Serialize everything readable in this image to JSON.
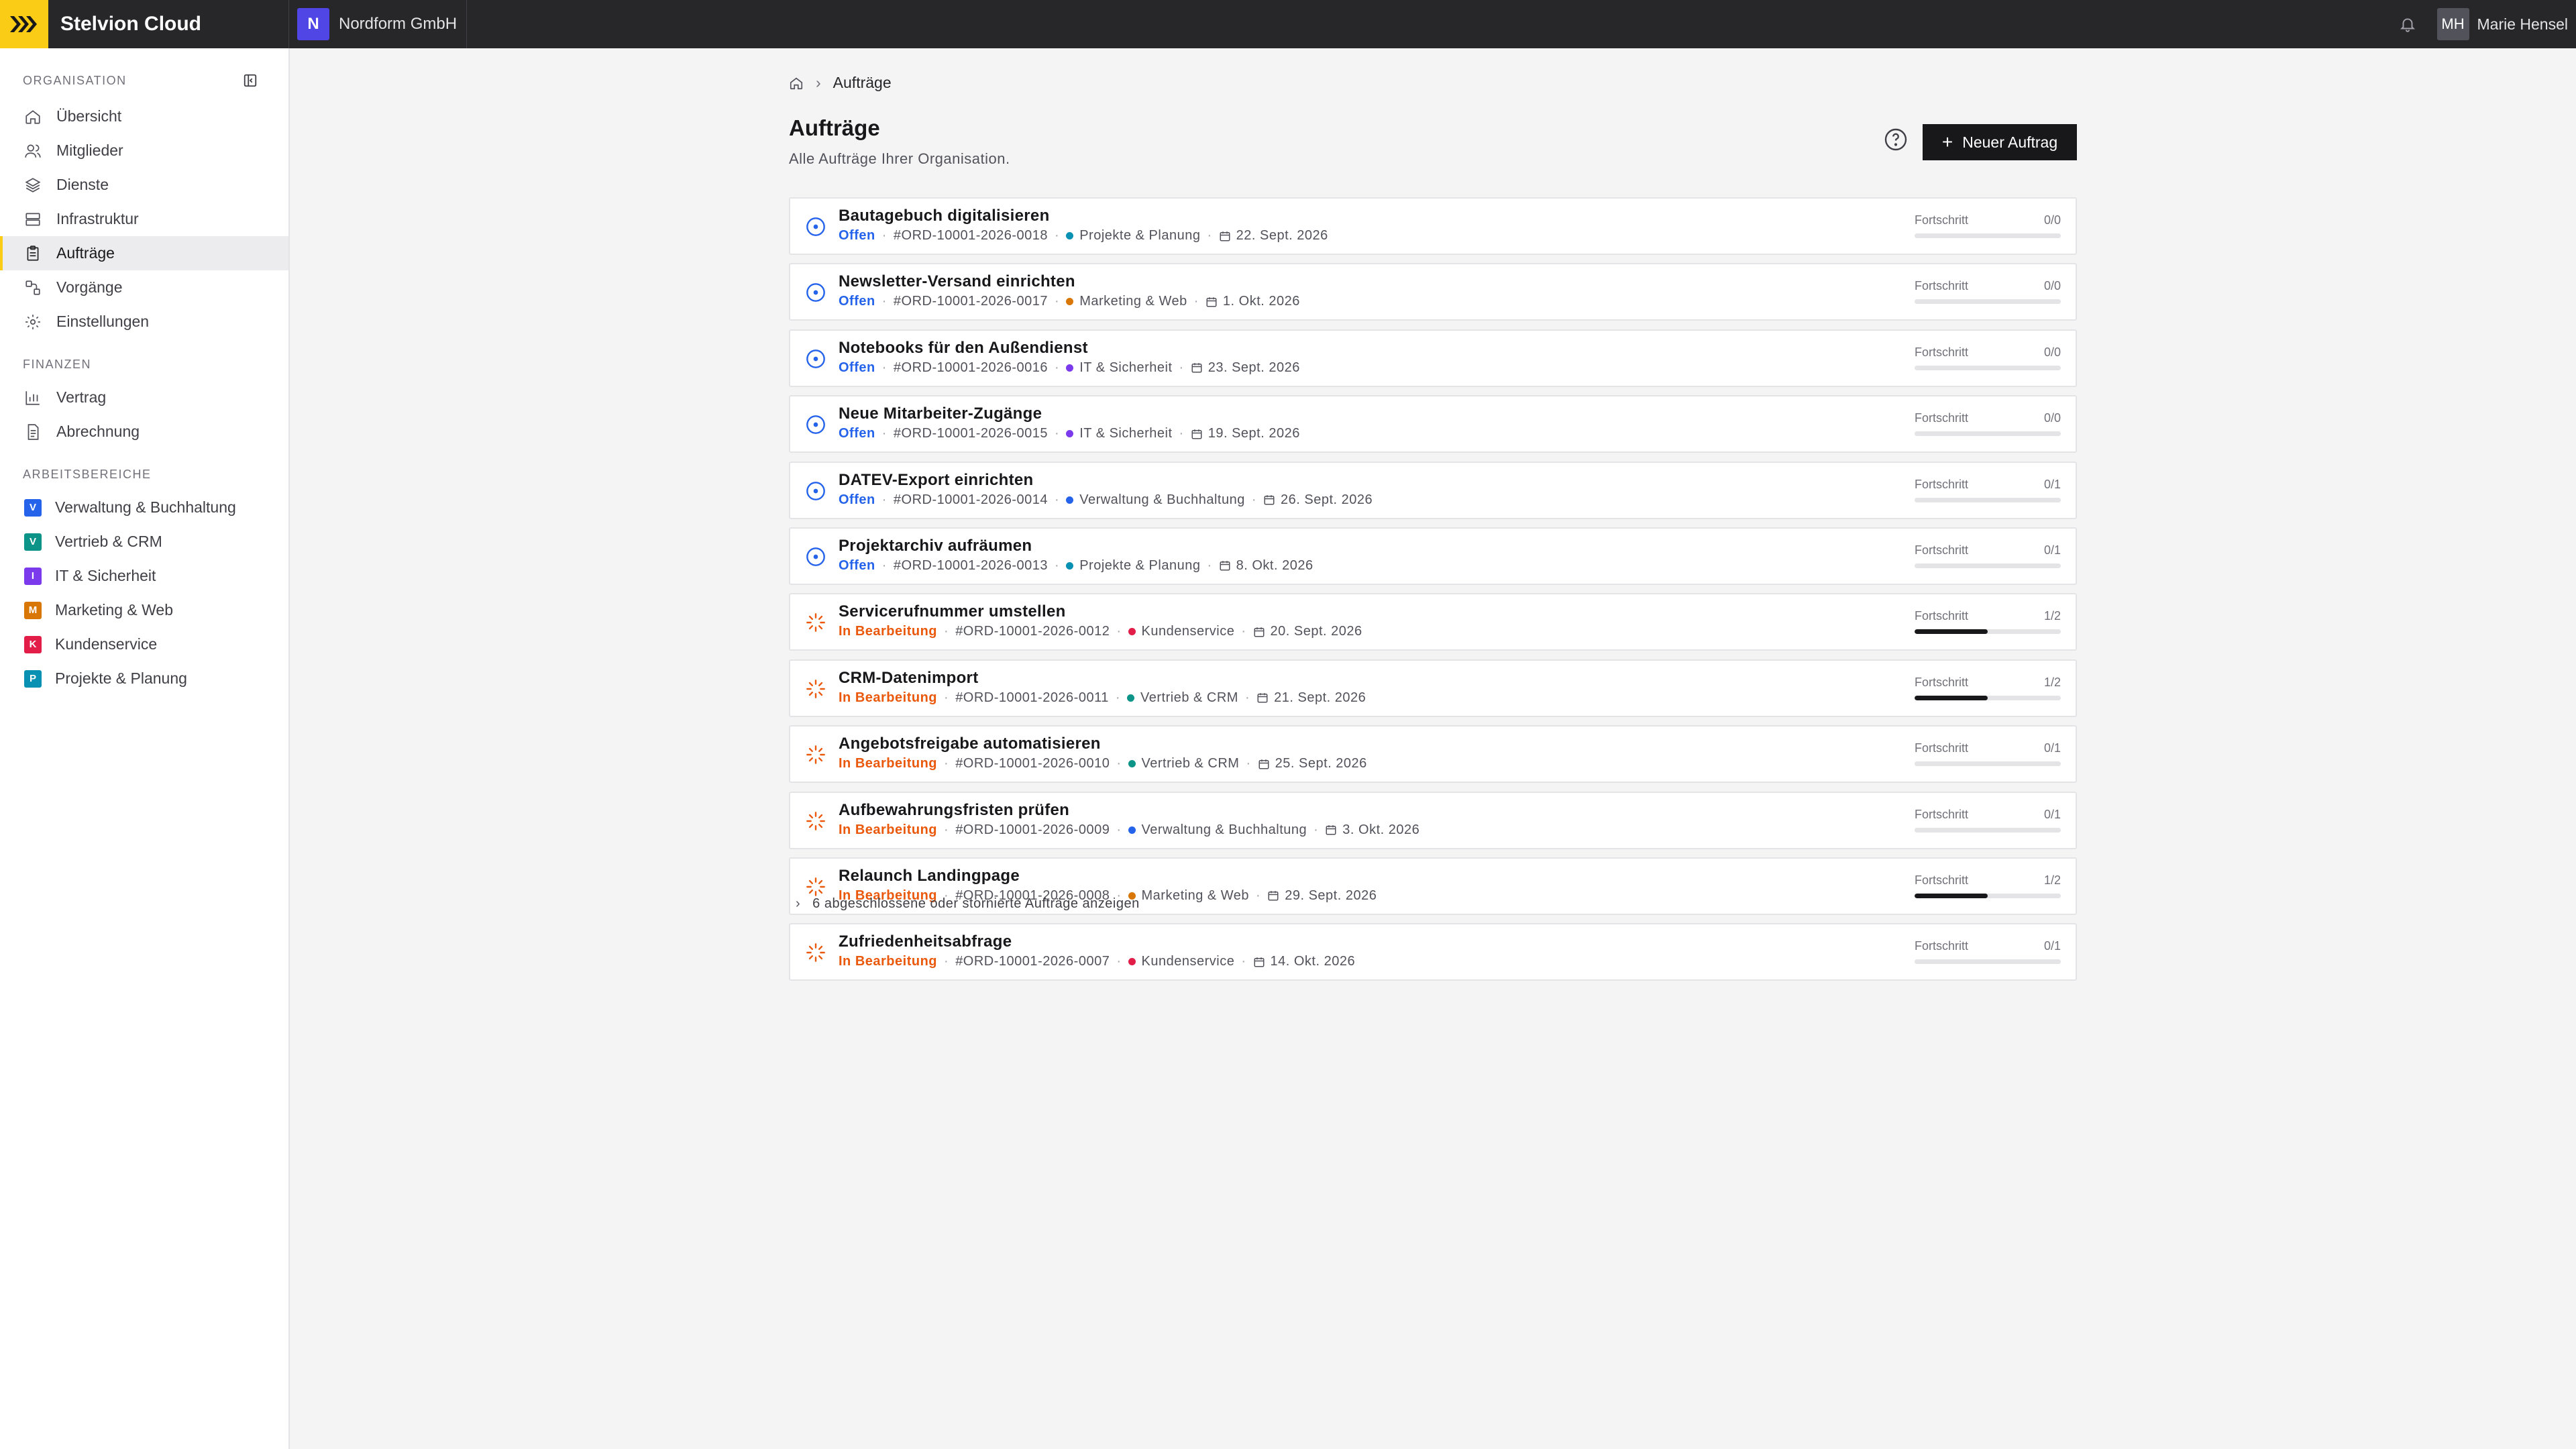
{
  "app": {
    "brand": "Stelvion Cloud",
    "org_initial": "N",
    "org_name": "Nordform GmbH"
  },
  "user": {
    "initials": "MH",
    "name": "Marie Hensel"
  },
  "sidebar": {
    "sections": [
      {
        "label": "ORGANISATION",
        "items": [
          {
            "label": "Übersicht",
            "icon": "home-icon"
          },
          {
            "label": "Mitglieder",
            "icon": "users-icon"
          },
          {
            "label": "Dienste",
            "icon": "layers-icon"
          },
          {
            "label": "Infrastruktur",
            "icon": "server-icon"
          },
          {
            "label": "Aufträge",
            "icon": "clipboard-icon",
            "active": true
          },
          {
            "label": "Vorgänge",
            "icon": "workflow-icon"
          },
          {
            "label": "Einstellungen",
            "icon": "gear-icon"
          }
        ]
      },
      {
        "label": "FINANZEN",
        "items": [
          {
            "label": "Vertrag",
            "icon": "bar-chart-icon"
          },
          {
            "label": "Abrechnung",
            "icon": "document-icon"
          }
        ]
      },
      {
        "label": "ARBEITSBEREICHE",
        "items": [
          {
            "label": "Verwaltung & Buchhaltung",
            "letter": "V",
            "color": "#2563eb"
          },
          {
            "label": "Vertrieb & CRM",
            "letter": "V",
            "color": "#0d9488"
          },
          {
            "label": "IT & Sicherheit",
            "letter": "I",
            "color": "#7c3aed"
          },
          {
            "label": "Marketing & Web",
            "letter": "M",
            "color": "#d97706"
          },
          {
            "label": "Kundenservice",
            "letter": "K",
            "color": "#e11d48"
          },
          {
            "label": "Projekte & Planung",
            "letter": "P",
            "color": "#0891b2"
          }
        ]
      }
    ]
  },
  "breadcrumb": {
    "current": "Aufträge"
  },
  "page": {
    "title": "Aufträge",
    "subtitle": "Alle Aufträge Ihrer Organisation.",
    "new_button": "Neuer Auftrag"
  },
  "progress_label": "Fortschritt",
  "orders": [
    {
      "title": "Bautagebuch digitalisieren",
      "status": "Offen",
      "status_type": "open",
      "id": "#ORD-10001-2026-0018",
      "workspace": "Projekte & Planung",
      "ws_color": "#0891b2",
      "date": "22. Sept. 2026",
      "progress": "0/0",
      "fraction": 0
    },
    {
      "title": "Newsletter-Versand einrichten",
      "status": "Offen",
      "status_type": "open",
      "id": "#ORD-10001-2026-0017",
      "workspace": "Marketing & Web",
      "ws_color": "#d97706",
      "date": "1. Okt. 2026",
      "progress": "0/0",
      "fraction": 0
    },
    {
      "title": "Notebooks für den Außendienst",
      "status": "Offen",
      "status_type": "open",
      "id": "#ORD-10001-2026-0016",
      "workspace": "IT & Sicherheit",
      "ws_color": "#7c3aed",
      "date": "23. Sept. 2026",
      "progress": "0/0",
      "fraction": 0
    },
    {
      "title": "Neue Mitarbeiter-Zugänge",
      "status": "Offen",
      "status_type": "open",
      "id": "#ORD-10001-2026-0015",
      "workspace": "IT & Sicherheit",
      "ws_color": "#7c3aed",
      "date": "19. Sept. 2026",
      "progress": "0/0",
      "fraction": 0
    },
    {
      "title": "DATEV-Export einrichten",
      "status": "Offen",
      "status_type": "open",
      "id": "#ORD-10001-2026-0014",
      "workspace": "Verwaltung & Buchhaltung",
      "ws_color": "#2563eb",
      "date": "26. Sept. 2026",
      "progress": "0/1",
      "fraction": 0
    },
    {
      "title": "Projektarchiv aufräumen",
      "status": "Offen",
      "status_type": "open",
      "id": "#ORD-10001-2026-0013",
      "workspace": "Projekte & Planung",
      "ws_color": "#0891b2",
      "date": "8. Okt. 2026",
      "progress": "0/1",
      "fraction": 0
    },
    {
      "title": "Servicerufnummer umstellen",
      "status": "In Bearbeitung",
      "status_type": "progress",
      "id": "#ORD-10001-2026-0012",
      "workspace": "Kundenservice",
      "ws_color": "#e11d48",
      "date": "20. Sept. 2026",
      "progress": "1/2",
      "fraction": 0.5
    },
    {
      "title": "CRM-Datenimport",
      "status": "In Bearbeitung",
      "status_type": "progress",
      "id": "#ORD-10001-2026-0011",
      "workspace": "Vertrieb & CRM",
      "ws_color": "#0d9488",
      "date": "21. Sept. 2026",
      "progress": "1/2",
      "fraction": 0.5
    },
    {
      "title": "Angebotsfreigabe automatisieren",
      "status": "In Bearbeitung",
      "status_type": "progress",
      "id": "#ORD-10001-2026-0010",
      "workspace": "Vertrieb & CRM",
      "ws_color": "#0d9488",
      "date": "25. Sept. 2026",
      "progress": "0/1",
      "fraction": 0
    },
    {
      "title": "Aufbewahrungsfristen prüfen",
      "status": "In Bearbeitung",
      "status_type": "progress",
      "id": "#ORD-10001-2026-0009",
      "workspace": "Verwaltung & Buchhaltung",
      "ws_color": "#2563eb",
      "date": "3. Okt. 2026",
      "progress": "0/1",
      "fraction": 0
    },
    {
      "title": "Relaunch Landingpage",
      "status": "In Bearbeitung",
      "status_type": "progress",
      "id": "#ORD-10001-2026-0008",
      "workspace": "Marketing & Web",
      "ws_color": "#d97706",
      "date": "29. Sept. 2026",
      "progress": "1/2",
      "fraction": 0.5
    },
    {
      "title": "Zufriedenheitsabfrage",
      "status": "In Bearbeitung",
      "status_type": "progress",
      "id": "#ORD-10001-2026-0007",
      "workspace": "Kundenservice",
      "ws_color": "#e11d48",
      "date": "14. Okt. 2026",
      "progress": "0/1",
      "fraction": 0
    }
  ],
  "more_link": "6 abgeschlossene oder stornierte Aufträge anzeigen",
  "colors": {
    "accent": "#facc15",
    "open": "#2563eb",
    "in_progress": "#ea580c"
  }
}
